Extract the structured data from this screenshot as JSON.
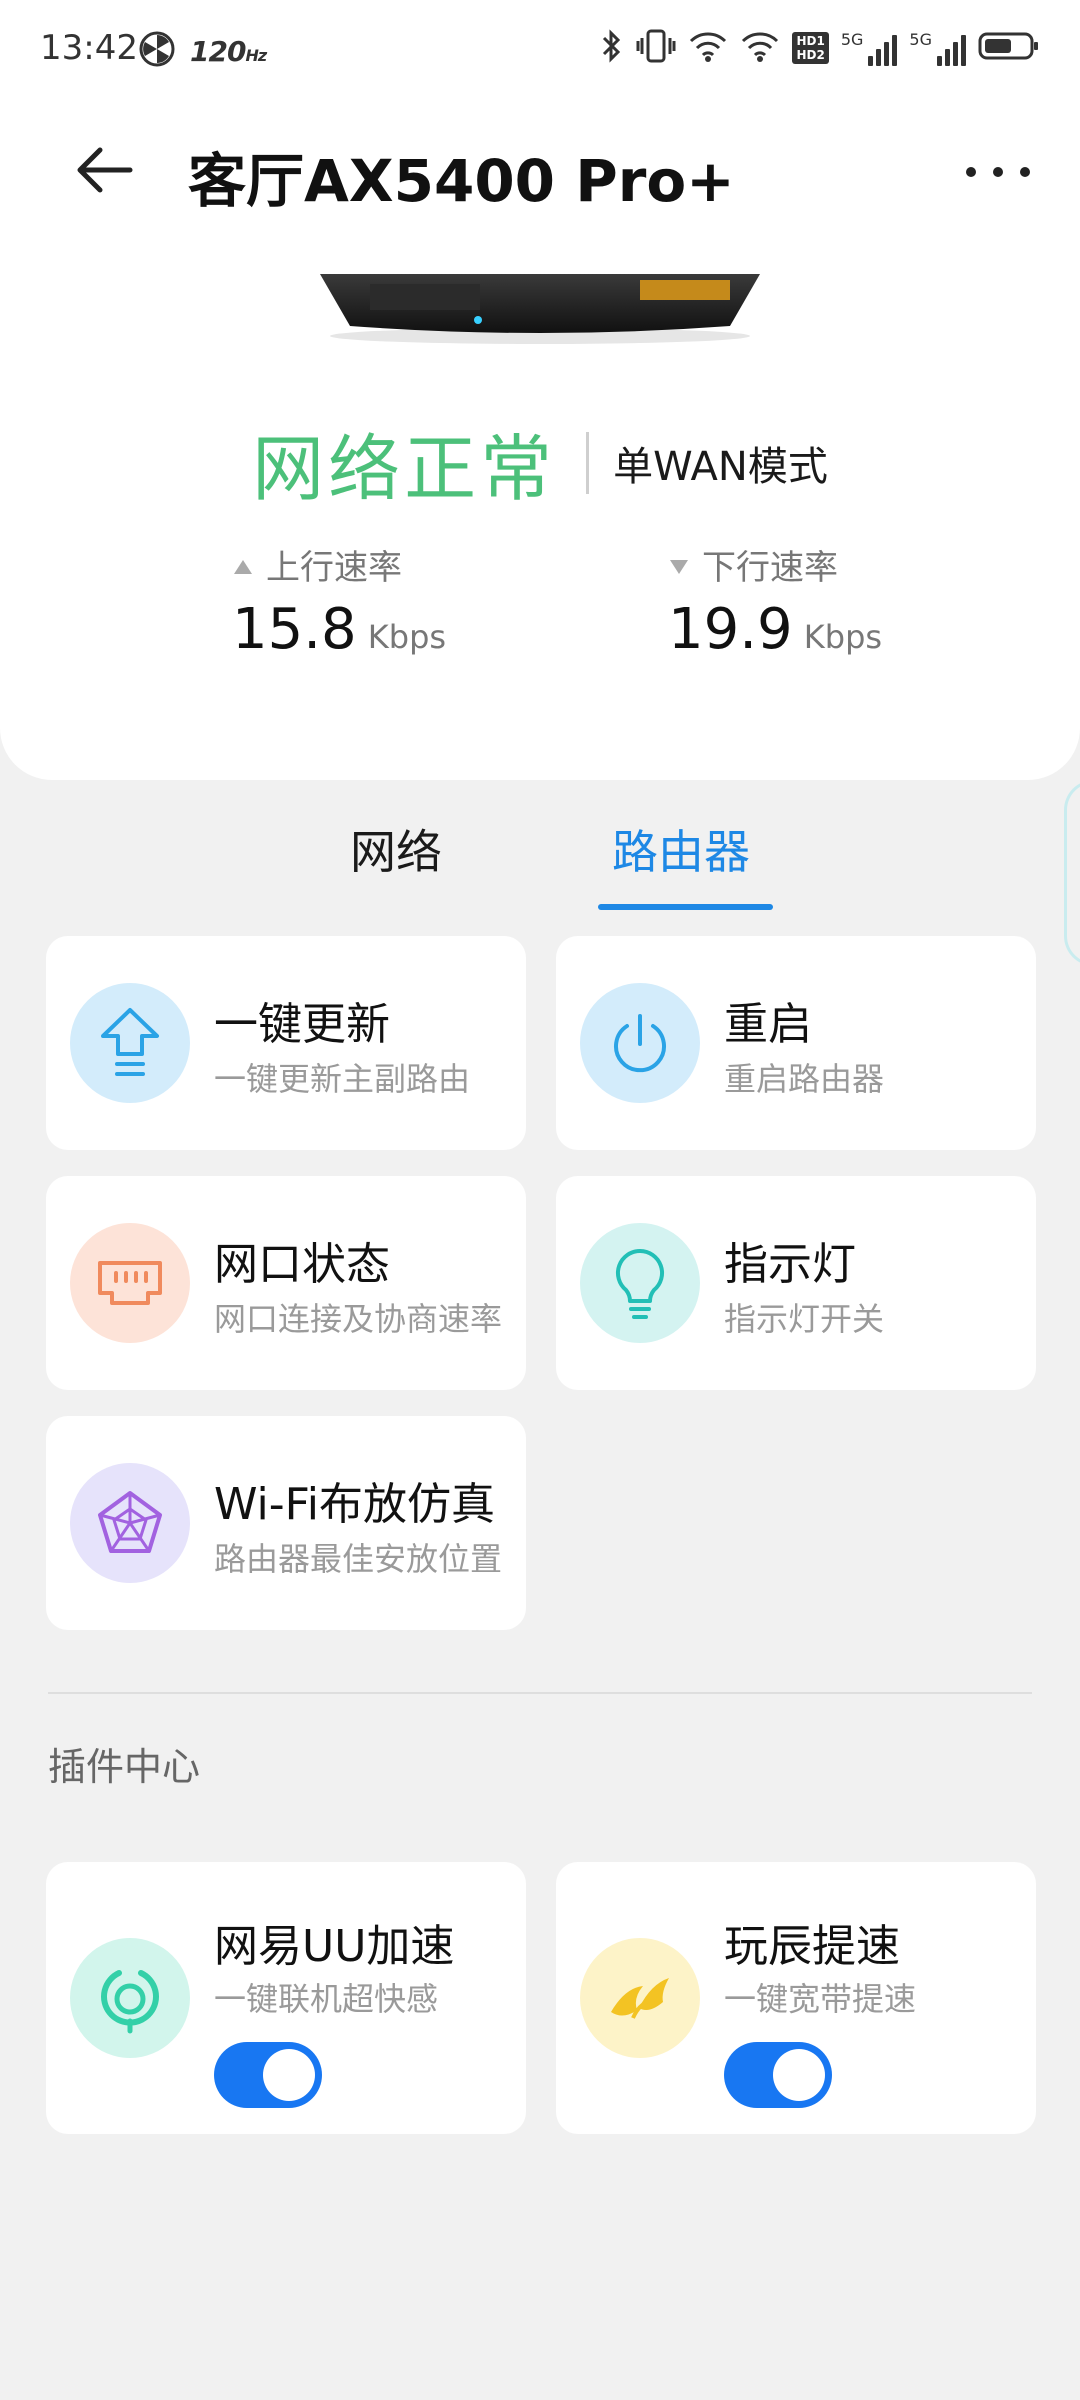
{
  "status_bar": {
    "time": "13:42",
    "refresh_rate": "120",
    "refresh_unit": "Hz",
    "hd_badge_top": "HD1",
    "hd_badge_bottom": "HD2",
    "net_1": "5G",
    "net_2": "5G",
    "icons": [
      "pinwheel-icon",
      "bluetooth-icon",
      "vibrate-icon",
      "wifi-icon",
      "wifi-icon",
      "hd-badge-icon",
      "signal-icon",
      "signal-icon",
      "battery-icon"
    ]
  },
  "header": {
    "title": "客厅AX5400 Pro+",
    "back_icon": "arrow-left-icon",
    "more_icon": "more-dots-icon"
  },
  "status": {
    "network_status": "网络正常",
    "wan_mode": "单WAN模式",
    "status_color": "#4cc07a"
  },
  "rates": {
    "upload_label": "上行速率",
    "upload_value": "15.8",
    "upload_unit": "Kbps",
    "download_label": "下行速率",
    "download_value": "19.9",
    "download_unit": "Kbps"
  },
  "tabs": {
    "items": [
      {
        "label": "网络",
        "active": false
      },
      {
        "label": "路由器",
        "active": true
      }
    ],
    "active_color": "#1e88e5"
  },
  "router_cards": [
    {
      "title": "一键更新",
      "subtitle": "一键更新主副路由",
      "icon": "upgrade-arrow-icon"
    },
    {
      "title": "重启",
      "subtitle": "重启路由器",
      "icon": "power-icon"
    },
    {
      "title": "网口状态",
      "subtitle": "网口连接及协商速率",
      "icon": "ethernet-port-icon"
    },
    {
      "title": "指示灯",
      "subtitle": "指示灯开关",
      "icon": "lightbulb-icon"
    },
    {
      "title": "Wi-Fi布放仿真",
      "subtitle": "路由器最佳安放位置",
      "icon": "radar-icon"
    }
  ],
  "plugins": {
    "section_title": "插件中心",
    "items": [
      {
        "title": "网易UU加速",
        "subtitle": "一键联机超快感",
        "icon": "uu-booster-icon",
        "enabled": true
      },
      {
        "title": "玩辰提速",
        "subtitle": "一键宽带提速",
        "icon": "wanchen-logo-icon",
        "enabled": true
      }
    ],
    "toggle_color": "#1877f2"
  }
}
